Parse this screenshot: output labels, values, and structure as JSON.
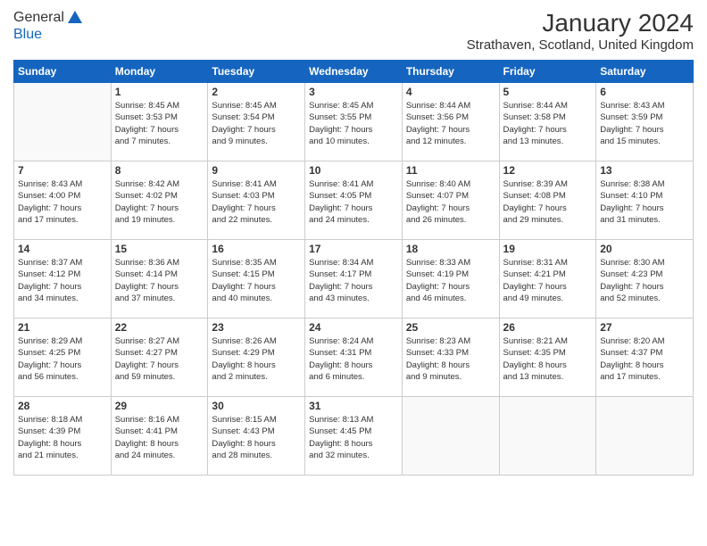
{
  "header": {
    "logo": {
      "line1": "General",
      "line2": "Blue"
    },
    "title": "January 2024",
    "location": "Strathaven, Scotland, United Kingdom"
  },
  "days_of_week": [
    "Sunday",
    "Monday",
    "Tuesday",
    "Wednesday",
    "Thursday",
    "Friday",
    "Saturday"
  ],
  "weeks": [
    [
      {
        "day": "",
        "info": ""
      },
      {
        "day": "1",
        "info": "Sunrise: 8:45 AM\nSunset: 3:53 PM\nDaylight: 7 hours\nand 7 minutes."
      },
      {
        "day": "2",
        "info": "Sunrise: 8:45 AM\nSunset: 3:54 PM\nDaylight: 7 hours\nand 9 minutes."
      },
      {
        "day": "3",
        "info": "Sunrise: 8:45 AM\nSunset: 3:55 PM\nDaylight: 7 hours\nand 10 minutes."
      },
      {
        "day": "4",
        "info": "Sunrise: 8:44 AM\nSunset: 3:56 PM\nDaylight: 7 hours\nand 12 minutes."
      },
      {
        "day": "5",
        "info": "Sunrise: 8:44 AM\nSunset: 3:58 PM\nDaylight: 7 hours\nand 13 minutes."
      },
      {
        "day": "6",
        "info": "Sunrise: 8:43 AM\nSunset: 3:59 PM\nDaylight: 7 hours\nand 15 minutes."
      }
    ],
    [
      {
        "day": "7",
        "info": "Sunrise: 8:43 AM\nSunset: 4:00 PM\nDaylight: 7 hours\nand 17 minutes."
      },
      {
        "day": "8",
        "info": "Sunrise: 8:42 AM\nSunset: 4:02 PM\nDaylight: 7 hours\nand 19 minutes."
      },
      {
        "day": "9",
        "info": "Sunrise: 8:41 AM\nSunset: 4:03 PM\nDaylight: 7 hours\nand 22 minutes."
      },
      {
        "day": "10",
        "info": "Sunrise: 8:41 AM\nSunset: 4:05 PM\nDaylight: 7 hours\nand 24 minutes."
      },
      {
        "day": "11",
        "info": "Sunrise: 8:40 AM\nSunset: 4:07 PM\nDaylight: 7 hours\nand 26 minutes."
      },
      {
        "day": "12",
        "info": "Sunrise: 8:39 AM\nSunset: 4:08 PM\nDaylight: 7 hours\nand 29 minutes."
      },
      {
        "day": "13",
        "info": "Sunrise: 8:38 AM\nSunset: 4:10 PM\nDaylight: 7 hours\nand 31 minutes."
      }
    ],
    [
      {
        "day": "14",
        "info": "Sunrise: 8:37 AM\nSunset: 4:12 PM\nDaylight: 7 hours\nand 34 minutes."
      },
      {
        "day": "15",
        "info": "Sunrise: 8:36 AM\nSunset: 4:14 PM\nDaylight: 7 hours\nand 37 minutes."
      },
      {
        "day": "16",
        "info": "Sunrise: 8:35 AM\nSunset: 4:15 PM\nDaylight: 7 hours\nand 40 minutes."
      },
      {
        "day": "17",
        "info": "Sunrise: 8:34 AM\nSunset: 4:17 PM\nDaylight: 7 hours\nand 43 minutes."
      },
      {
        "day": "18",
        "info": "Sunrise: 8:33 AM\nSunset: 4:19 PM\nDaylight: 7 hours\nand 46 minutes."
      },
      {
        "day": "19",
        "info": "Sunrise: 8:31 AM\nSunset: 4:21 PM\nDaylight: 7 hours\nand 49 minutes."
      },
      {
        "day": "20",
        "info": "Sunrise: 8:30 AM\nSunset: 4:23 PM\nDaylight: 7 hours\nand 52 minutes."
      }
    ],
    [
      {
        "day": "21",
        "info": "Sunrise: 8:29 AM\nSunset: 4:25 PM\nDaylight: 7 hours\nand 56 minutes."
      },
      {
        "day": "22",
        "info": "Sunrise: 8:27 AM\nSunset: 4:27 PM\nDaylight: 7 hours\nand 59 minutes."
      },
      {
        "day": "23",
        "info": "Sunrise: 8:26 AM\nSunset: 4:29 PM\nDaylight: 8 hours\nand 2 minutes."
      },
      {
        "day": "24",
        "info": "Sunrise: 8:24 AM\nSunset: 4:31 PM\nDaylight: 8 hours\nand 6 minutes."
      },
      {
        "day": "25",
        "info": "Sunrise: 8:23 AM\nSunset: 4:33 PM\nDaylight: 8 hours\nand 9 minutes."
      },
      {
        "day": "26",
        "info": "Sunrise: 8:21 AM\nSunset: 4:35 PM\nDaylight: 8 hours\nand 13 minutes."
      },
      {
        "day": "27",
        "info": "Sunrise: 8:20 AM\nSunset: 4:37 PM\nDaylight: 8 hours\nand 17 minutes."
      }
    ],
    [
      {
        "day": "28",
        "info": "Sunrise: 8:18 AM\nSunset: 4:39 PM\nDaylight: 8 hours\nand 21 minutes."
      },
      {
        "day": "29",
        "info": "Sunrise: 8:16 AM\nSunset: 4:41 PM\nDaylight: 8 hours\nand 24 minutes."
      },
      {
        "day": "30",
        "info": "Sunrise: 8:15 AM\nSunset: 4:43 PM\nDaylight: 8 hours\nand 28 minutes."
      },
      {
        "day": "31",
        "info": "Sunrise: 8:13 AM\nSunset: 4:45 PM\nDaylight: 8 hours\nand 32 minutes."
      },
      {
        "day": "",
        "info": ""
      },
      {
        "day": "",
        "info": ""
      },
      {
        "day": "",
        "info": ""
      }
    ]
  ]
}
